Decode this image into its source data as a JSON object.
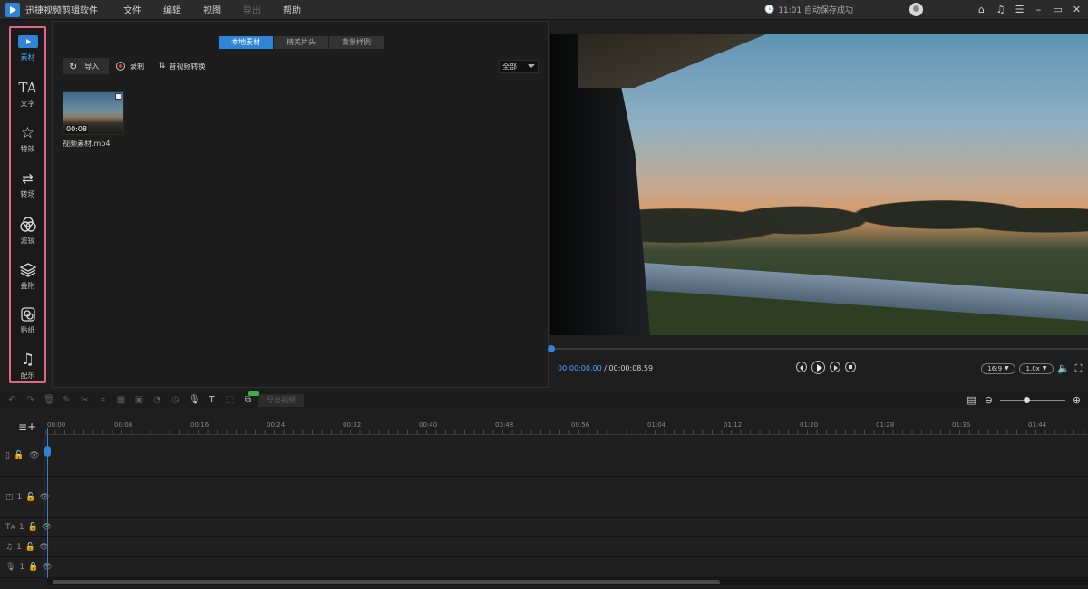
{
  "app": {
    "title": "迅捷视频剪辑软件",
    "menu": [
      "文件",
      "编辑",
      "视图",
      "导出",
      "帮助"
    ],
    "save_status": "11:01 自动保存成功"
  },
  "sidebar": {
    "items": [
      {
        "label": "素材",
        "icon": "media-icon"
      },
      {
        "label": "文字",
        "icon": "text-icon"
      },
      {
        "label": "特效",
        "icon": "effects-icon"
      },
      {
        "label": "转场",
        "icon": "transition-icon"
      },
      {
        "label": "滤镜",
        "icon": "filter-icon"
      },
      {
        "label": "叠附",
        "icon": "overlay-icon"
      },
      {
        "label": "贴纸",
        "icon": "sticker-icon"
      },
      {
        "label": "配乐",
        "icon": "music-icon"
      }
    ]
  },
  "media": {
    "tabs": [
      "本地素材",
      "精美片头",
      "背景样例"
    ],
    "import_label": "导入",
    "record_label": "录制",
    "convert_label": "音视频转换",
    "filter_value": "全部",
    "items": [
      {
        "name": "视频素材.mp4",
        "duration": "00:08"
      }
    ]
  },
  "preview": {
    "current_time": "00:00:00.00",
    "total_time": "00:00:08.59",
    "aspect": "16:9",
    "speed": "1.0x"
  },
  "timeline": {
    "export_label": "导出视频",
    "ticks": [
      "00:00",
      "00:08",
      "00:16",
      "00:24",
      "00:32",
      "00:40",
      "00:48",
      "00:56",
      "01:04",
      "01:12",
      "01:20",
      "01:28",
      "01:36",
      "01:44"
    ],
    "track_numbers": [
      "1",
      "1",
      "1",
      "1"
    ]
  },
  "colors": {
    "accent": "#2f84d8",
    "highlight_border": "#e0668a"
  }
}
